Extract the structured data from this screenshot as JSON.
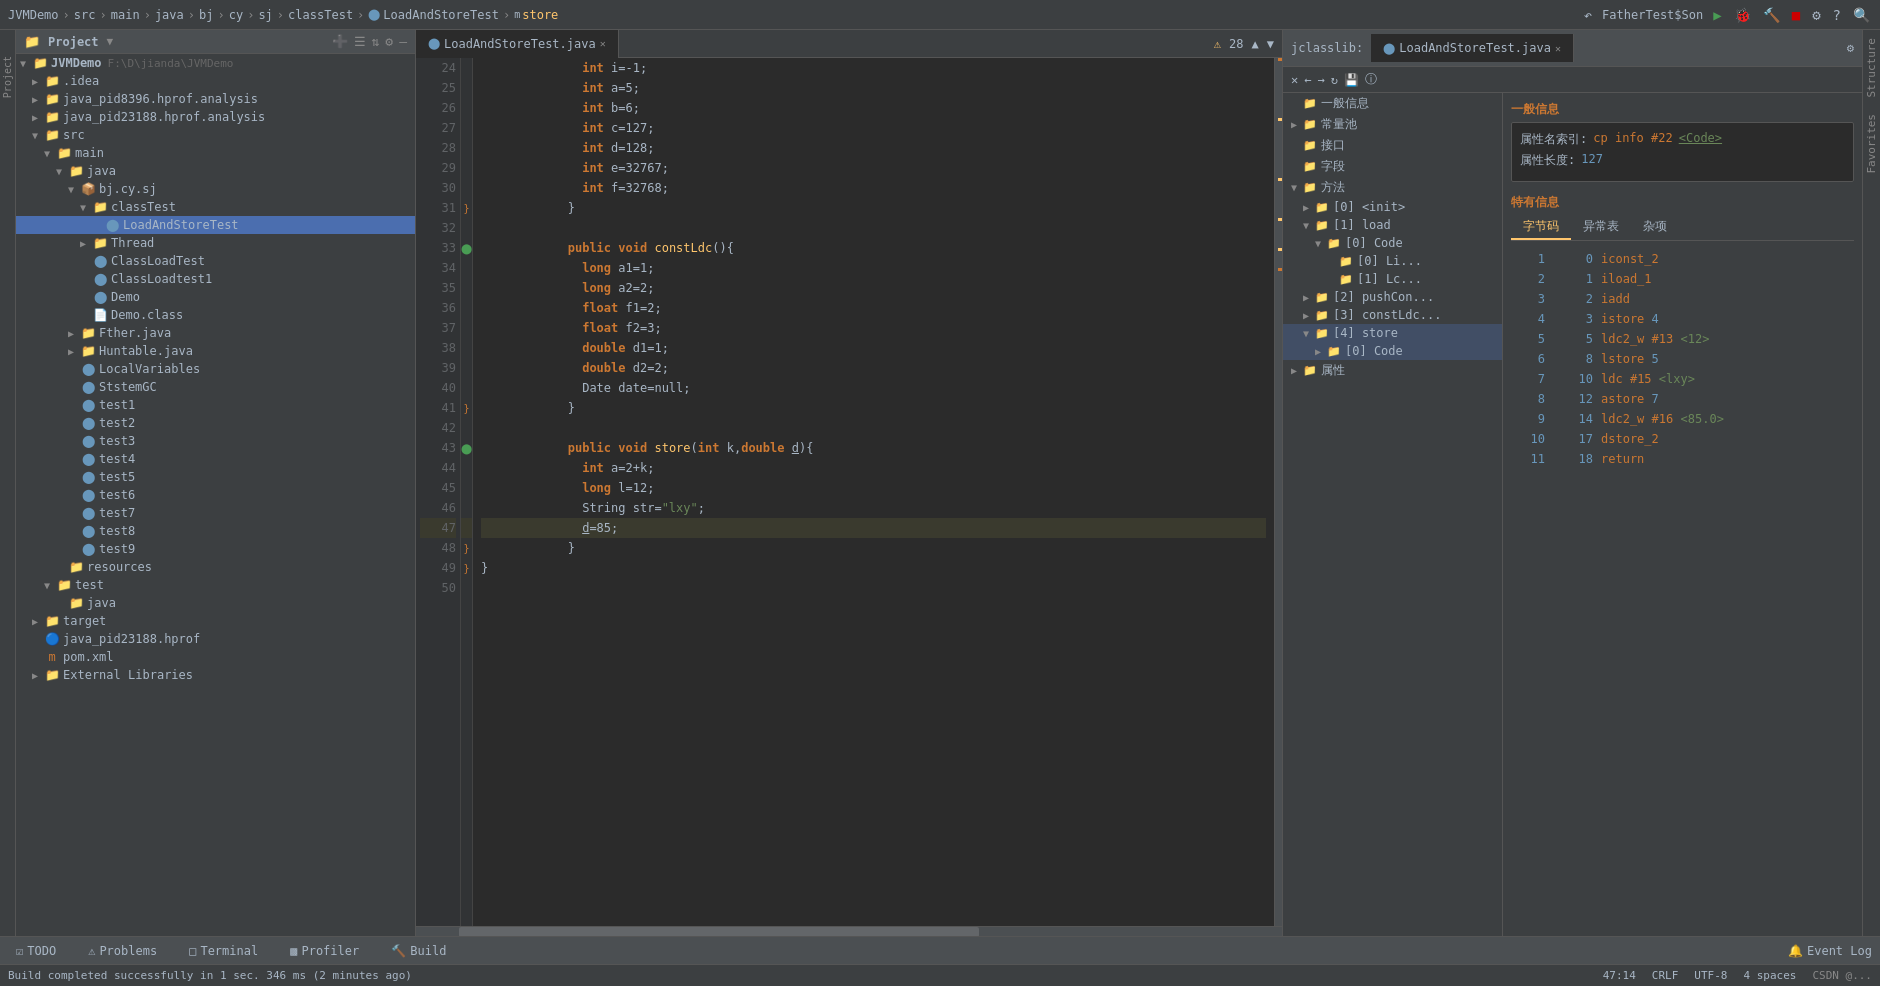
{
  "topbar": {
    "breadcrumb": [
      "JVMDemo",
      "src",
      "main",
      "java",
      "bj",
      "cy",
      "sj",
      "classTest",
      "LoadAndStoreTest",
      "store"
    ],
    "run_config": "FatherTest$Son",
    "toolbar_icons": [
      "back",
      "forward",
      "build",
      "debug",
      "run",
      "coverage",
      "profile",
      "stop",
      "help",
      "search",
      "settings"
    ]
  },
  "project_panel": {
    "title": "Project",
    "root": "JVMDemo",
    "root_path": "F:\\D\\jianda\\JVMDemo",
    "items": [
      {
        "label": ".idea",
        "type": "folder",
        "indent": 1,
        "expanded": false
      },
      {
        "label": "java_pid8396.hprof.analysis",
        "type": "folder",
        "indent": 1,
        "expanded": false
      },
      {
        "label": "java_pid23188.hprof.analysis",
        "type": "folder",
        "indent": 1,
        "expanded": false
      },
      {
        "label": "src",
        "type": "folder",
        "indent": 1,
        "expanded": true
      },
      {
        "label": "main",
        "type": "folder",
        "indent": 2,
        "expanded": true
      },
      {
        "label": "java",
        "type": "folder",
        "indent": 3,
        "expanded": true
      },
      {
        "label": "bj.cy.sj",
        "type": "package",
        "indent": 4,
        "expanded": true
      },
      {
        "label": "classTest",
        "type": "folder",
        "indent": 5,
        "expanded": true
      },
      {
        "label": "LoadAndStoreTest",
        "type": "java",
        "indent": 6,
        "selected": true
      },
      {
        "label": "Thread",
        "type": "folder",
        "indent": 5,
        "expanded": false
      },
      {
        "label": "ClassLoadTest",
        "type": "java",
        "indent": 5
      },
      {
        "label": "ClassLoadtest1",
        "type": "java",
        "indent": 5
      },
      {
        "label": "Demo",
        "type": "java",
        "indent": 5
      },
      {
        "label": "Demo.class",
        "type": "file",
        "indent": 5
      },
      {
        "label": "Fther.java",
        "type": "folder",
        "indent": 4,
        "expanded": false
      },
      {
        "label": "Huntable.java",
        "type": "folder",
        "indent": 4,
        "expanded": false
      },
      {
        "label": "LocalVariables",
        "type": "java",
        "indent": 4
      },
      {
        "label": "StstemGC",
        "type": "java",
        "indent": 4
      },
      {
        "label": "test1",
        "type": "java",
        "indent": 4
      },
      {
        "label": "test2",
        "type": "java",
        "indent": 4
      },
      {
        "label": "test3",
        "type": "java",
        "indent": 4
      },
      {
        "label": "test4",
        "type": "java",
        "indent": 4
      },
      {
        "label": "test5",
        "type": "java",
        "indent": 4
      },
      {
        "label": "test6",
        "type": "java",
        "indent": 4
      },
      {
        "label": "test7",
        "type": "java",
        "indent": 4
      },
      {
        "label": "test8",
        "type": "java",
        "indent": 4
      },
      {
        "label": "test9",
        "type": "java",
        "indent": 4
      },
      {
        "label": "resources",
        "type": "folder",
        "indent": 3,
        "expanded": false
      },
      {
        "label": "test",
        "type": "folder",
        "indent": 2,
        "expanded": true
      },
      {
        "label": "java",
        "type": "folder",
        "indent": 3,
        "expanded": false
      },
      {
        "label": "target",
        "type": "folder",
        "indent": 1,
        "expanded": false
      },
      {
        "label": "java_pid23188.hprof",
        "type": "hprof",
        "indent": 1
      },
      {
        "label": "pom.xml",
        "type": "xml",
        "indent": 1
      },
      {
        "label": "External Libraries",
        "type": "folder",
        "indent": 1,
        "expanded": false
      }
    ]
  },
  "editor": {
    "tab_label": "LoadAndStoreTest.java",
    "warning_count": "28",
    "lines": [
      {
        "num": 24,
        "code": "    int i=-1;",
        "highlight": false
      },
      {
        "num": 25,
        "code": "    int a=5;",
        "highlight": false
      },
      {
        "num": 26,
        "code": "    int b=6;",
        "highlight": false
      },
      {
        "num": 27,
        "code": "    int c=127;",
        "highlight": false
      },
      {
        "num": 28,
        "code": "    int d=128;",
        "highlight": false
      },
      {
        "num": 29,
        "code": "    int e=32767;",
        "highlight": false
      },
      {
        "num": 30,
        "code": "    int f=32768;",
        "highlight": false
      },
      {
        "num": 31,
        "code": "  }",
        "highlight": false
      },
      {
        "num": 32,
        "code": "",
        "highlight": false
      },
      {
        "num": 33,
        "code": "  public void constLdc(){",
        "highlight": false
      },
      {
        "num": 34,
        "code": "    long a1=1;",
        "highlight": false
      },
      {
        "num": 35,
        "code": "    long a2=2;",
        "highlight": false
      },
      {
        "num": 36,
        "code": "    float f1=2;",
        "highlight": false
      },
      {
        "num": 37,
        "code": "    float f2=3;",
        "highlight": false
      },
      {
        "num": 38,
        "code": "    double d1=1;",
        "highlight": false
      },
      {
        "num": 39,
        "code": "    double d2=2;",
        "highlight": false
      },
      {
        "num": 40,
        "code": "    Date date=null;",
        "highlight": false
      },
      {
        "num": 41,
        "code": "  }",
        "highlight": false
      },
      {
        "num": 42,
        "code": "",
        "highlight": false
      },
      {
        "num": 43,
        "code": "  public void store(int k,double d){",
        "highlight": false
      },
      {
        "num": 44,
        "code": "    int a=2+k;",
        "highlight": false
      },
      {
        "num": 45,
        "code": "    long l=12;",
        "highlight": false
      },
      {
        "num": 46,
        "code": "    String str=\"lxy\";",
        "highlight": false
      },
      {
        "num": 47,
        "code": "    d=85;",
        "highlight": true
      },
      {
        "num": 48,
        "code": "  }",
        "highlight": false
      },
      {
        "num": 49,
        "code": "}",
        "highlight": false
      },
      {
        "num": 50,
        "code": "",
        "highlight": false
      }
    ]
  },
  "jclasslib": {
    "tab_label": "LoadAndStoreTest.java",
    "tree": {
      "items": [
        {
          "label": "一般信息",
          "type": "leaf",
          "indent": 0
        },
        {
          "label": "常量池",
          "type": "parent",
          "indent": 0,
          "expanded": false
        },
        {
          "label": "接口",
          "type": "leaf",
          "indent": 0
        },
        {
          "label": "字段",
          "type": "leaf",
          "indent": 0
        },
        {
          "label": "方法",
          "type": "parent",
          "indent": 0,
          "expanded": true,
          "children": [
            {
              "label": "[0] <init>",
              "type": "leaf",
              "indent": 1
            },
            {
              "label": "[1] load",
              "type": "parent",
              "indent": 1,
              "expanded": true,
              "children": [
                {
                  "label": "[0] Code",
                  "type": "parent",
                  "indent": 2,
                  "expanded": true,
                  "children": [
                    {
                      "label": "[0] Li...",
                      "type": "leaf",
                      "indent": 3
                    },
                    {
                      "label": "[1] Lc...",
                      "type": "leaf",
                      "indent": 3
                    }
                  ]
                }
              ]
            },
            {
              "label": "[2] pushCon...",
              "type": "leaf",
              "indent": 1
            },
            {
              "label": "[3] constLdc...",
              "type": "leaf",
              "indent": 1
            },
            {
              "label": "[4] store",
              "type": "parent",
              "indent": 1,
              "expanded": true,
              "selected": true,
              "children": [
                {
                  "label": "[0] Code",
                  "type": "leaf",
                  "indent": 2,
                  "selected": true
                }
              ]
            }
          ]
        },
        {
          "label": "属性",
          "type": "parent",
          "indent": 0,
          "expanded": false
        }
      ]
    },
    "detail": {
      "section1_title": "一般信息",
      "attr_name_label": "属性名索引:",
      "attr_name_value": "cp info #22",
      "attr_name_code": "<Code>",
      "attr_len_label": "属性长度:",
      "attr_len_value": "127",
      "section2_title": "特有信息",
      "bytecode_tabs": [
        "字节码",
        "异常表",
        "杂项"
      ],
      "bytecode_tab_active": "字节码",
      "bytecodes": [
        {
          "line": 1,
          "offset": 0,
          "instruction": "iconst_2",
          "args": ""
        },
        {
          "line": 2,
          "offset": 1,
          "instruction": "iload_1",
          "args": ""
        },
        {
          "line": 3,
          "offset": 2,
          "instruction": "iadd",
          "args": ""
        },
        {
          "line": 4,
          "offset": 3,
          "instruction": "istore",
          "args": "4",
          "arg_type": "num"
        },
        {
          "line": 5,
          "offset": 5,
          "instruction": "ldc2_w",
          "args": "#13 <12>",
          "arg_type": "ref"
        },
        {
          "line": 6,
          "offset": 8,
          "instruction": "lstore",
          "args": "5",
          "arg_type": "num"
        },
        {
          "line": 7,
          "offset": 10,
          "instruction": "ldc",
          "args": "#15 <lxy>",
          "arg_type": "ref"
        },
        {
          "line": 8,
          "offset": 12,
          "instruction": "astore",
          "args": "7",
          "arg_type": "num"
        },
        {
          "line": 9,
          "offset": 14,
          "instruction": "ldc2_w",
          "args": "#16 <85.0>",
          "arg_type": "ref"
        },
        {
          "line": 10,
          "offset": 17,
          "instruction": "dstore_2",
          "args": ""
        },
        {
          "line": 11,
          "offset": 18,
          "instruction": "return",
          "args": ""
        }
      ]
    }
  },
  "bottom_tabs": [
    "TODO",
    "Problems",
    "Terminal",
    "Profiler",
    "Build"
  ],
  "status_bar": {
    "status": "Build completed successfully in 1 sec. 346 ms (2 minutes ago)",
    "position": "47:14",
    "encoding": "CRLF",
    "charset": "UTF-8",
    "indent": "4 spaces"
  },
  "right_panel": {
    "tabs": [
      "Structure",
      "Favorites"
    ]
  }
}
